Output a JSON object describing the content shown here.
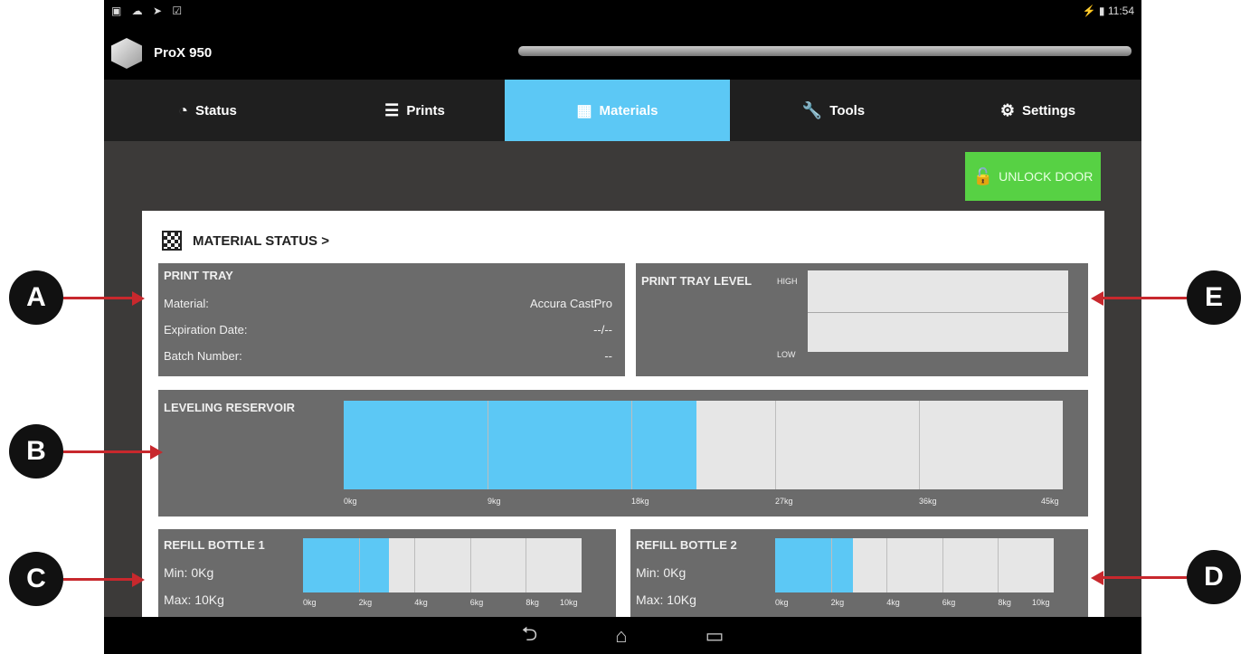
{
  "status_bar": {
    "left_icons": "▣ ☁ ➤ ☑",
    "right": "11:54",
    "wifi_battery": "⚡ ▮"
  },
  "app": {
    "name": "ProX 950"
  },
  "tabs": [
    {
      "label": "Status",
      "icon": "clock-icon"
    },
    {
      "label": "Prints",
      "icon": "list-icon"
    },
    {
      "label": "Materials",
      "icon": "checker-icon",
      "active": true
    },
    {
      "label": "Tools",
      "icon": "wrench-icon"
    },
    {
      "label": "Settings",
      "icon": "gear-icon"
    }
  ],
  "unlock_door": "UNLOCK DOOR",
  "material_status": {
    "heading": "MATERIAL STATUS >"
  },
  "print_tray": {
    "title": "PRINT TRAY",
    "rows": [
      {
        "label": "Material:",
        "value": "Accura CastPro"
      },
      {
        "label": "Expiration Date:",
        "value": "--/--"
      },
      {
        "label": "Batch Number:",
        "value": "--"
      }
    ]
  },
  "print_tray_level": {
    "title": "PRINT TRAY LEVEL",
    "high": "HIGH",
    "low": "LOW"
  },
  "leveling_reservoir": {
    "title": "LEVELING RESERVOIR",
    "ticks": [
      "0kg",
      "9kg",
      "18kg",
      "27kg",
      "36kg",
      "45kg"
    ],
    "fill_fraction": 0.49
  },
  "refill1": {
    "title": "REFILL BOTTLE 1",
    "min": "Min: 0Kg",
    "max": "Max: 10Kg",
    "ticks": [
      "0kg",
      "2kg",
      "4kg",
      "6kg",
      "8kg",
      "10kg"
    ],
    "fill_fraction": 0.31
  },
  "refill2": {
    "title": "REFILL BOTTLE 2",
    "min": "Min: 0Kg",
    "max": "Max: 10Kg",
    "ticks": [
      "0kg",
      "2kg",
      "4kg",
      "6kg",
      "8kg",
      "10kg"
    ],
    "fill_fraction": 0.28
  },
  "callouts": [
    "A",
    "B",
    "C",
    "D",
    "E"
  ],
  "nav": {
    "back": "⮌",
    "home": "⌂",
    "recent": "▭"
  }
}
